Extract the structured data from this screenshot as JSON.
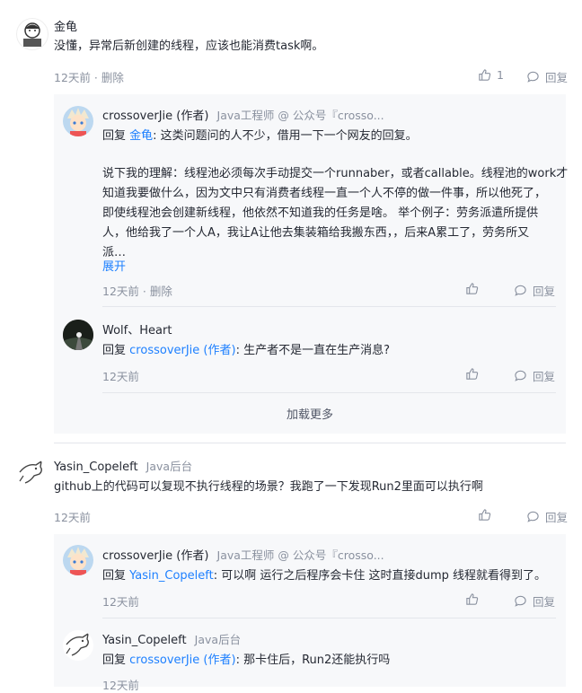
{
  "comments": [
    {
      "user": "金龟",
      "text": "没懂，异常后新创建的线程，应该也能消费task啊。",
      "time": "12天前",
      "delete": "删除",
      "likes": "1",
      "reply": "回复",
      "replies": [
        {
          "user": "crossoverJie (作者)",
          "title": "Java工程师 @ 公众号『crosso...",
          "prefix": "回复",
          "target": "金龟",
          "text1": ": 这类问题问的人不少，借用一下一个网友的回复。",
          "para2_line1": "说下我的理解：线程池必须每次手动提交一个runnaber，或者callable。线程池的work才",
          "para2_line2": "知道我要做什么，因为文中只有消费者线程一直一个人不停的做一件事，所以他死了，",
          "para2_line3": "即使线程池会创建新线程，他依然不知道我的任务是啥。 举个例子：劳务派遣所提供",
          "para2_line4": "人，他给我了一个人A，我让A让他去集装箱给我搬东西，，后来A累工了，劳务所又",
          "para2_line5": "派…",
          "expand": "展开",
          "time": "12天前",
          "delete": "删除",
          "reply": "回复"
        },
        {
          "user": "Wolf、Heart",
          "prefix": "回复",
          "target": "crossoverJie (作者)",
          "text": ": 生产者不是一直在生产消息?",
          "time": "12天前",
          "reply": "回复"
        }
      ],
      "load_more": "加载更多"
    },
    {
      "user": "Yasin_Copeleft",
      "title": "Java后台",
      "text": "github上的代码可以复现不执行线程的场景？我跑了一下发现Run2里面可以执行啊",
      "time": "12天前",
      "reply": "回复",
      "replies": [
        {
          "user": "crossoverJie (作者)",
          "title": "Java工程师 @ 公众号『crosso...",
          "prefix": "回复",
          "target": "Yasin_Copeleft",
          "text": ": 可以啊 运行之后程序会卡住 这时直接dump 线程就看得到了。",
          "time": "12天前",
          "reply": "回复"
        },
        {
          "user": "Yasin_Copeleft",
          "title": "Java后台",
          "prefix": "回复",
          "target": "crossoverJie (作者)",
          "text": ": 那卡住后，Run2还能执行吗",
          "time": "12天前"
        }
      ]
    }
  ],
  "icons": {
    "like": "thumbs-up-icon",
    "reply": "comment-bubble-icon"
  },
  "colors": {
    "link": "#1e80ff",
    "meta": "#8a919f",
    "subbox": "#f7f8fa"
  }
}
